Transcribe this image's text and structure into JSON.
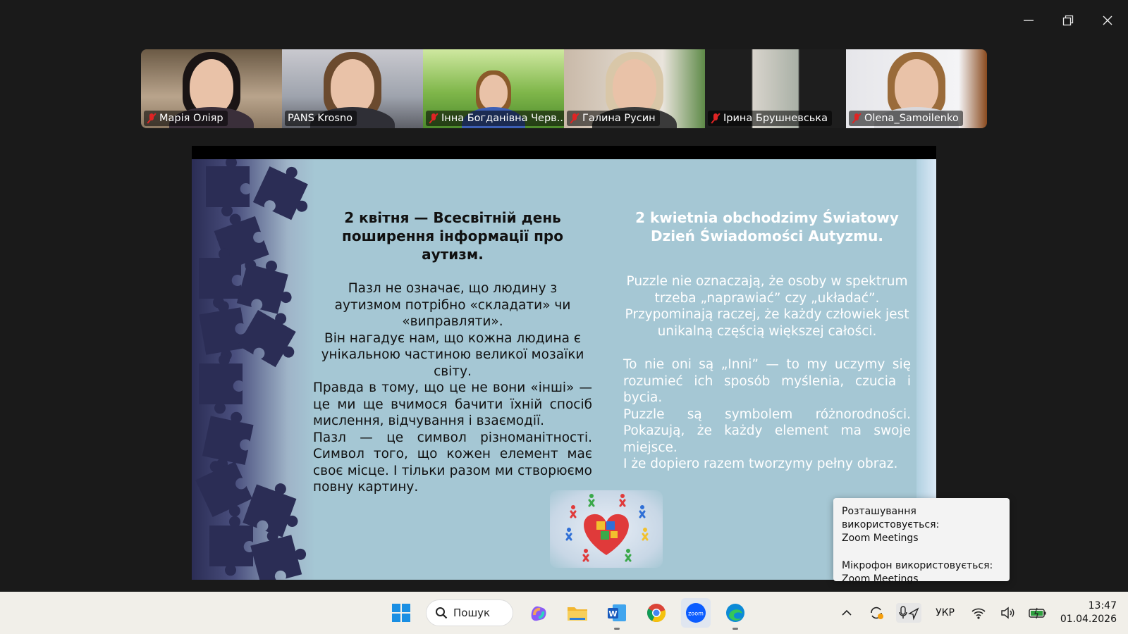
{
  "participants": [
    {
      "name": "Марія Оліяр",
      "muted": true
    },
    {
      "name": "PANS Krosno",
      "muted": false,
      "active_speaker": true
    },
    {
      "name": "Інна Богданівна Черв...",
      "muted": true
    },
    {
      "name": "Галина Русин",
      "muted": true
    },
    {
      "name": "Ірина Брушневська",
      "muted": true
    },
    {
      "name": "Olena_Samoilenko",
      "muted": true
    }
  ],
  "slide": {
    "left": {
      "title": "2 квітня — Всесвітній день поширення інформації про аутизм.",
      "p1": "Пазл не означає, що людину з аутизмом потрібно «складати» чи «виправляти».",
      "p2": "Він нагадує нам, що кожна людина є унікальною частиною великої мозаїки світу.",
      "p3": "Правда в тому, що це не вони «інші» — це ми ще вчимося бачити їхній спосіб мислення, відчування і взаємодії.",
      "p4": "Пазл — це символ різноманітності. Символ того, що кожен елемент має своє місце. І тільки разом ми створюємо повну картину."
    },
    "right": {
      "title": "2 kwietnia obchodzimy Światowy Dzień Świadomości Autyzmu.",
      "p1": "Puzzle nie oznaczają, że osoby w spektrum trzeba „naprawiać” czy „układać”. Przypominają raczej, że każdy człowiek jest unikalną częścią większej całości.",
      "p2": "To nie oni są „Inni” — to my uczymy się rozumieć ich sposób myślenia, czucia i bycia.",
      "p3": "Puzzle są symbolem różnorodności. Pokazują, że każdy element ma swoje miejsce.",
      "p4": "I że dopiero razem tworzymy pełny obraz."
    }
  },
  "notification": {
    "line1": "Розташування використовується:",
    "line2": "Zoom Meetings",
    "line3": "Мікрофон використовується:",
    "line4": "Zoom Meetings"
  },
  "taskbar": {
    "search_label": "Пошук",
    "language": "УКР",
    "time": "13:47",
    "date": "01.04.2026",
    "apps": [
      "start-icon",
      "copilot-icon",
      "file-explorer-icon",
      "word-icon",
      "chrome-icon",
      "zoom-icon",
      "edge-icon"
    ]
  },
  "colors": {
    "slide_bg": "#a5c7d4",
    "puzzle": "#2b2d55",
    "active_speaker": "#22c55e",
    "mute_red": "#e02424",
    "taskbar_bg": "#f1efe9"
  }
}
